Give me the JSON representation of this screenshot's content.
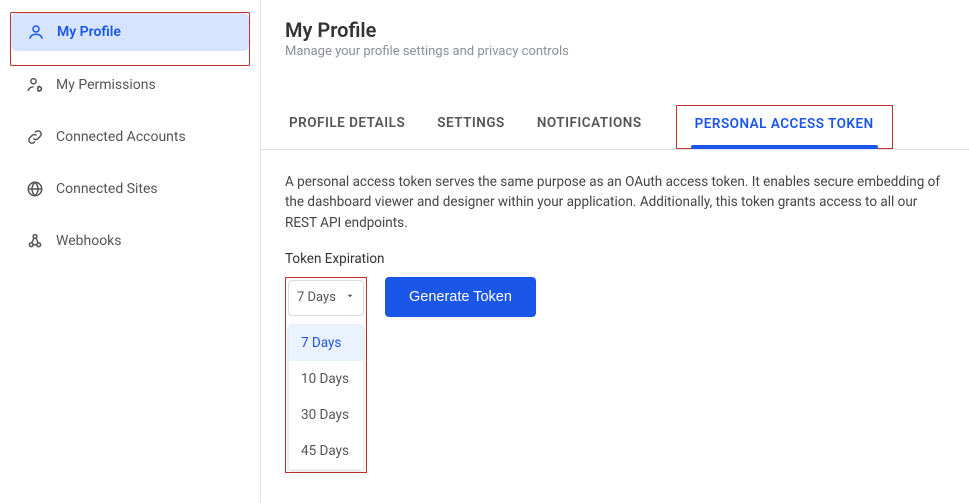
{
  "sidebar": {
    "items": [
      {
        "label": "My Profile",
        "icon": "user-icon",
        "active": true
      },
      {
        "label": "My Permissions",
        "icon": "user-gear-icon",
        "active": false
      },
      {
        "label": "Connected Accounts",
        "icon": "link-icon",
        "active": false
      },
      {
        "label": "Connected Sites",
        "icon": "globe-icon",
        "active": false
      },
      {
        "label": "Webhooks",
        "icon": "webhook-icon",
        "active": false
      }
    ]
  },
  "header": {
    "title": "My Profile",
    "subtitle": "Manage your profile settings and privacy controls"
  },
  "tabs": [
    {
      "label": "PROFILE DETAILS",
      "active": false
    },
    {
      "label": "SETTINGS",
      "active": false
    },
    {
      "label": "NOTIFICATIONS",
      "active": false
    },
    {
      "label": "PERSONAL ACCESS TOKEN",
      "active": true
    }
  ],
  "pat": {
    "description": "A personal access token serves the same purpose as an OAuth access token. It enables secure embedding of the dashboard viewer and designer within your application. Additionally, this token grants access to all our REST API endpoints.",
    "expiration_label": "Token Expiration",
    "selected": "7 Days",
    "options": [
      "7 Days",
      "10 Days",
      "30 Days",
      "45 Days"
    ],
    "generate_label": "Generate Token"
  }
}
